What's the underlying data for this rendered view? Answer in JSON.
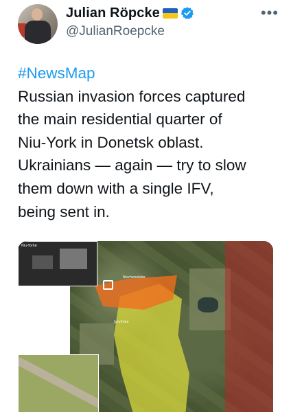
{
  "author": {
    "name": "Julian Röpcke",
    "handle": "@JulianRoepcke",
    "flag_emoji": "ukraine-flag",
    "verified_icon": "verified-badge-icon",
    "verified_color": "#1d9bf0"
  },
  "menu": {
    "more_label": "•••"
  },
  "tweet": {
    "hashtag": "#NewsMap",
    "lines": [
      "Russian invasion forces captured",
      "the main residential quarter of",
      "Niu-York in Donetsk oblast.",
      "Ukrainians — again — try to slow",
      "them down with a single IFV,",
      "being sent in."
    ]
  },
  "media": {
    "inset_label": "Niu-Yorke",
    "village_label": "Novhorodske",
    "district_label": "Jurylivka"
  },
  "colors": {
    "link": "#1d9bf0",
    "text": "#0f1419",
    "muted": "#536471",
    "yellow_zone": "#dcdc3c",
    "red_zone": "#b42828",
    "orange_zone": "#f06e1e"
  }
}
